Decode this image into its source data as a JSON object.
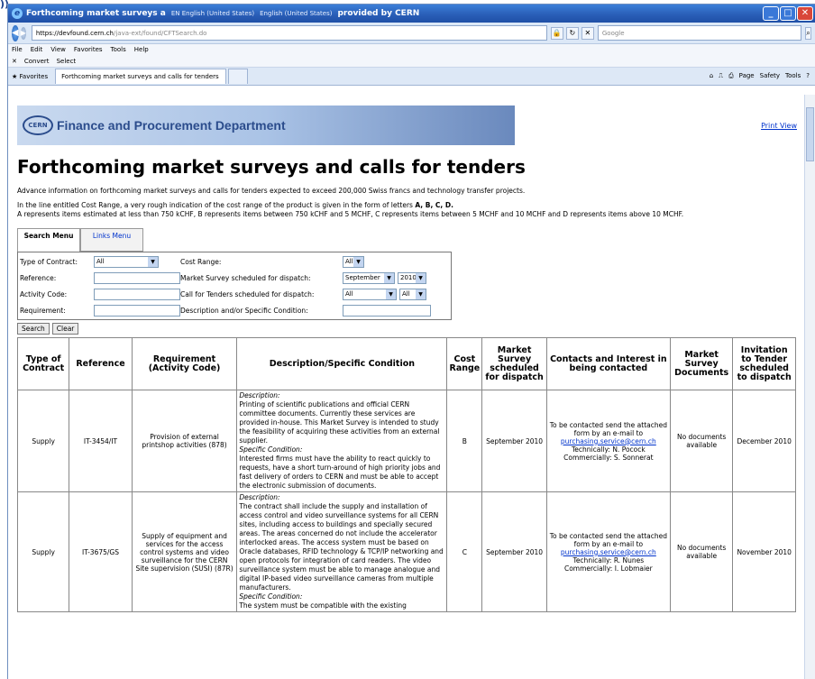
{
  "corner_text": ")) .",
  "window": {
    "title": "Forthcoming market surveys a",
    "lang1": "EN English (United States)",
    "lang2": "English (United States)",
    "provided": "provided by CERN"
  },
  "address": {
    "https": "https://devfound.cern.ch",
    "path": "/java-ext/found/CFTSearch.do"
  },
  "search_placeholder": "Google",
  "menu": [
    "File",
    "Edit",
    "View",
    "Favorites",
    "Tools",
    "Help"
  ],
  "toolbar": {
    "convert": "Convert",
    "select": "Select"
  },
  "tabs": {
    "favorites": "Favorites",
    "active": "Forthcoming market surveys and calls for tenders"
  },
  "commands": [
    "Page",
    "Safety",
    "Tools"
  ],
  "banner": {
    "logo": "CERN",
    "title": "Finance and Procurement Department"
  },
  "print_view": "Print View",
  "page_title": "Forthcoming market surveys and calls for tenders",
  "intro": "Advance information on forthcoming market surveys and calls for tenders expected to exceed 200,000 Swiss francs and technology transfer projects.",
  "cost_p1": "In the line entitled Cost Range, a very rough indication of the cost range of the product is given in the form of letters",
  "cost_letters": "A, B, C, D.",
  "cost_p2": "A represents items estimated at less than 750 kCHF, B represents items between 750 kCHF and 5 MCHF, C represents items between 5 MCHF and 10 MCHF and D represents items above 10 MCHF.",
  "menus": {
    "search": "Search Menu",
    "links": "Links Menu"
  },
  "form": {
    "type_label": "Type of Contract:",
    "type_value": "All",
    "cost_label": "Cost Range:",
    "cost_value": "All",
    "reference_label": "Reference:",
    "ms_label": "Market Survey scheduled for dispatch:",
    "ms_month": "September",
    "ms_year": "2010",
    "activity_label": "Activity Code:",
    "cft_label": "Call for Tenders scheduled for dispatch:",
    "cft_month": "All",
    "cft_year": "All",
    "requirement_label": "Requirement:",
    "desc_label": "Description and/or Specific Condition:",
    "search_btn": "Search",
    "clear_btn": "Clear"
  },
  "table": {
    "headers": [
      "Type of Contract",
      "Reference",
      "Requirement (Activity Code)",
      "Description/Specific Condition",
      "Cost Range",
      "Market Survey scheduled for dispatch",
      "Contacts and Interest in being contacted",
      "Market Survey Documents",
      "Invitation to Tender scheduled to dispatch"
    ],
    "rows": [
      {
        "type": "Supply",
        "reference": "IT-3454/IT",
        "requirement": "Provision of external printshop activities (878)",
        "desc_label": "Description:",
        "desc": "Printing of scientific publications and official CERN committee documents. Currently these services are provided in-house. This Market Survey is intended to study the feasibility of acquiring these activities from an external supplier.",
        "cond_label": "Specific Condition:",
        "cond": "Interested firms must have the ability to react quickly to requests, have a short turn-around of high priority jobs and fast delivery of orders to CERN and must be able to accept the electronic submission of documents.",
        "cost": "B",
        "ms": "September 2010",
        "contact_pre": "To be contacted send the attached form by an e-mail to",
        "email": "purchasing.service@cern.ch",
        "tech": "Technically: N. Pocock",
        "comm": "Commercially: S. Sonnerat",
        "docs": "No documents available",
        "itt": "December 2010"
      },
      {
        "type": "Supply",
        "reference": "IT-3675/GS",
        "requirement": "Supply of equipment and services for the access control systems and video surveillance for the CERN Site supervision (SUSI) (87R)",
        "desc_label": "Description:",
        "desc": "The contract shall include the supply and installation of access control and video surveillance systems for all CERN sites, including access to buildings and specially secured areas. The areas concerned do not include the accelerator interlocked areas. The access system must be based on Oracle databases, RFID technology & TCP/IP networking and open protocols for integration of card readers. The video surveillance system must be able to manage analogue and digital IP-based video surveillance cameras from multiple manufacturers.",
        "cond_label": "Specific Condition:",
        "cond": "The system must be compatible with the existing",
        "cost": "C",
        "ms": "September 2010",
        "contact_pre": "To be contacted send the attached form by an e-mail to",
        "email": "purchasing.service@cern.ch",
        "tech": "Technically: R. Nunes",
        "comm": "Commercially: I. Lobmaier",
        "docs": "No documents available",
        "itt": "November 2010"
      }
    ]
  }
}
